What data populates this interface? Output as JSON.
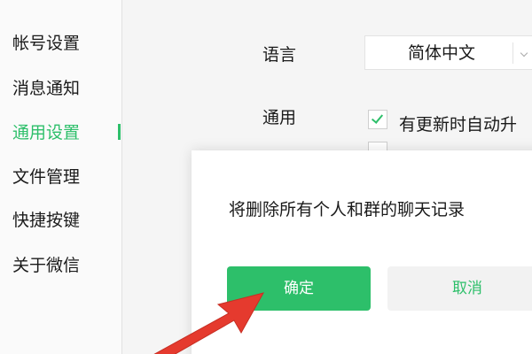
{
  "sidebar": {
    "items": [
      {
        "label": "帐号设置",
        "active": false
      },
      {
        "label": "消息通知",
        "active": false
      },
      {
        "label": "通用设置",
        "active": true
      },
      {
        "label": "文件管理",
        "active": false
      },
      {
        "label": "快捷按键",
        "active": false
      },
      {
        "label": "关于微信",
        "active": false
      }
    ]
  },
  "settings": {
    "language_label": "语言",
    "language_value": "简体中文",
    "general_label": "通用",
    "auto_update_label": "有更新时自动升",
    "auto_update_checked": true
  },
  "dialog": {
    "message": "将删除所有个人和群的聊天记录",
    "confirm_label": "确定",
    "cancel_label": "取消"
  },
  "colors": {
    "accent": "#2dbf6a",
    "annotation_arrow": "#e53a2e"
  }
}
